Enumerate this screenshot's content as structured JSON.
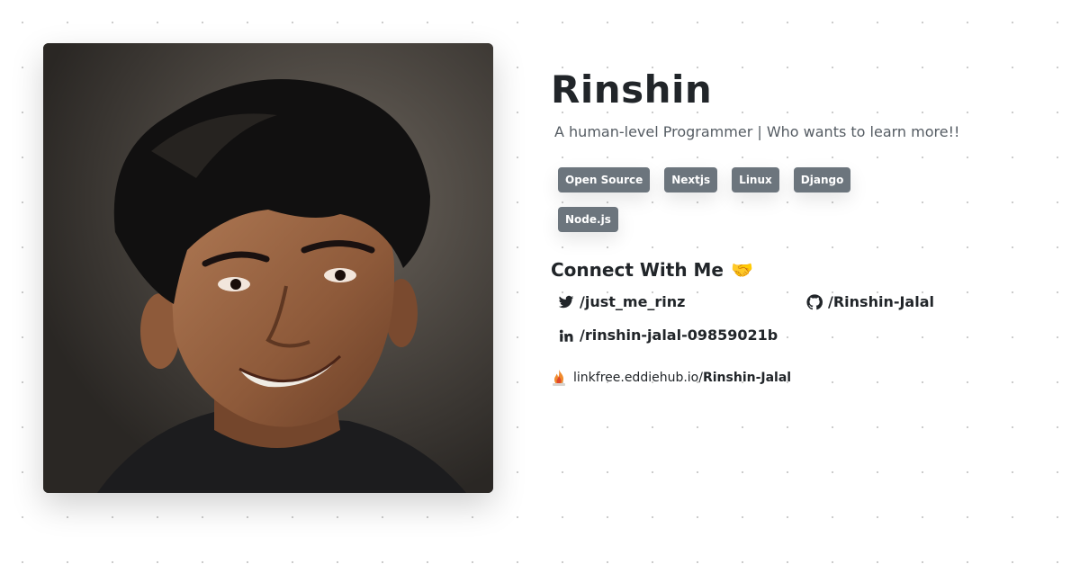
{
  "profile": {
    "name": "Rinshin",
    "bio": "A human-level Programmer | Who wants to learn more!!",
    "tags": [
      "Open Source",
      "Nextjs",
      "Linux",
      "Django",
      "Node.js"
    ]
  },
  "connect": {
    "title": "Connect With Me",
    "emoji": "🤝",
    "twitter": {
      "icon": "twitter-icon",
      "label": "/just_me_rinz"
    },
    "github": {
      "icon": "github-icon",
      "label": "/Rinshin-Jalal"
    },
    "linkedin": {
      "icon": "linkedin-icon",
      "label": "/rinshin-jalal-09859021b"
    }
  },
  "footer": {
    "icon": "linkfree-flame-icon",
    "domain": "linkfree.eddiehub.io/",
    "handle": "Rinshin-Jalal"
  }
}
